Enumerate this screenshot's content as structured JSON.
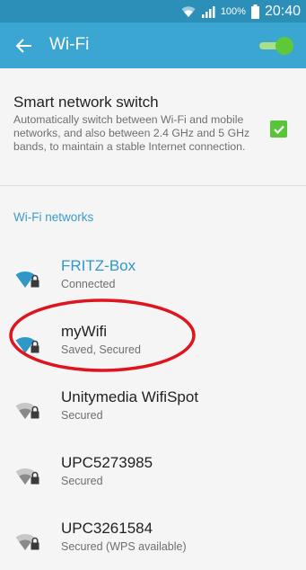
{
  "status_bar": {
    "battery_percent": "100%",
    "time": "20:40"
  },
  "app_bar": {
    "title": "Wi-Fi",
    "wifi_enabled": true
  },
  "smart_switch": {
    "title": "Smart network switch",
    "description": "Automatically switch between Wi-Fi and mobile networks, and also between 2.4 GHz and 5 GHz bands, to maintain a stable Internet connection.",
    "checked": true
  },
  "networks_section": {
    "title": "Wi-Fi networks",
    "items": [
      {
        "name": "FRITZ-Box",
        "status": "Connected",
        "active": true,
        "icon": "wifi-lock-icon"
      },
      {
        "name": "myWifi",
        "status": "Saved, Secured",
        "active": false,
        "icon": "wifi-lock-icon"
      },
      {
        "name": "Unitymedia WifiSpot",
        "status": "Secured",
        "active": false,
        "icon": "wifi-lock-icon"
      },
      {
        "name": "UPC5273985",
        "status": "Secured",
        "active": false,
        "icon": "wifi-lock-icon"
      },
      {
        "name": "UPC3261584",
        "status": "Secured (WPS available)",
        "active": false,
        "icon": "wifi-lock-icon"
      }
    ]
  },
  "colors": {
    "status_bar": "#2c8fb8",
    "app_bar": "#3ba6d1",
    "accent": "#3a9ccc",
    "toggle_on": "#5cc83a",
    "annotation": "#e0141e"
  }
}
